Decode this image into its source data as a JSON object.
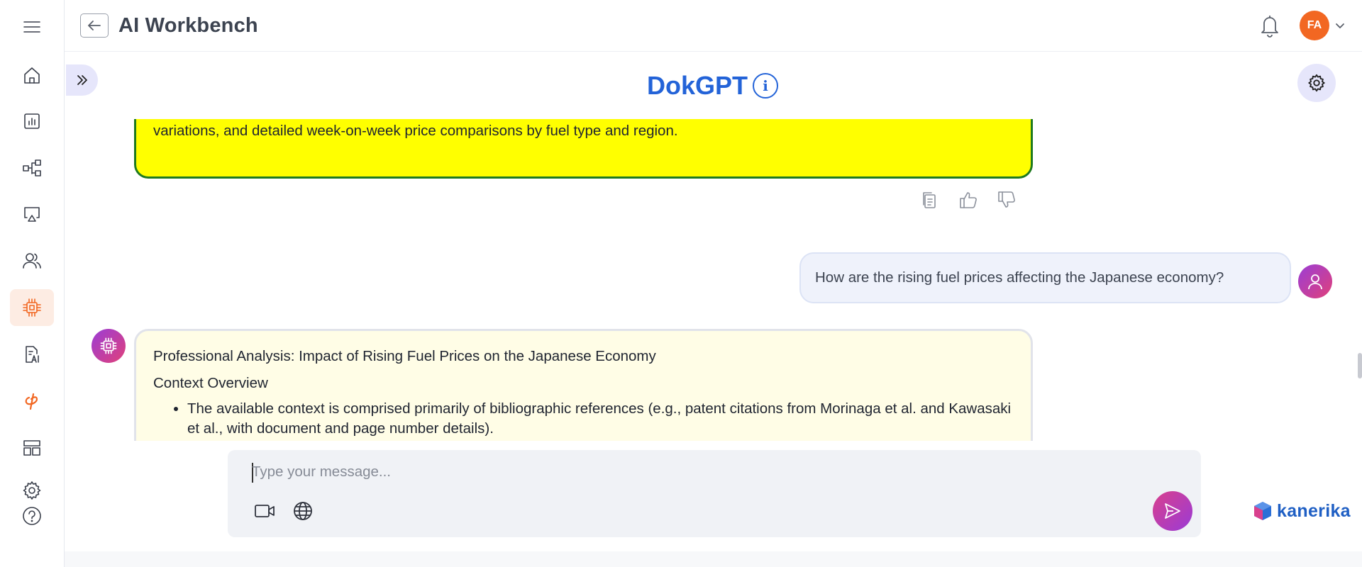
{
  "header": {
    "app_title": "AI Workbench",
    "avatar_initials": "FA"
  },
  "sidebar": {
    "items": [
      {
        "icon": "hamburger-menu-icon"
      },
      {
        "icon": "home-icon"
      },
      {
        "icon": "bar-chart-icon"
      },
      {
        "icon": "workflow-icon"
      },
      {
        "icon": "presentation-icon"
      },
      {
        "icon": "users-icon"
      },
      {
        "icon": "cpu-chip-icon",
        "active": true
      },
      {
        "icon": "ai-document-icon"
      },
      {
        "icon": "phi-icon"
      },
      {
        "icon": "layout-icon"
      },
      {
        "icon": "settings-gear-icon"
      },
      {
        "icon": "help-icon"
      }
    ]
  },
  "page": {
    "title": "DokGPT",
    "info_glyph": "i"
  },
  "chat": {
    "previous_answer_tail": "variations, and detailed week-on-week price comparisons by fuel type and region.",
    "user_question": "How are the rising fuel prices affecting the Japanese economy?",
    "answer": {
      "heading": "Professional Analysis: Impact of Rising Fuel Prices on the Japanese Economy",
      "subheading": "Context Overview",
      "bullets": [
        "The available context is comprised primarily of bibliographic references (e.g., patent citations from Morinaga et al. and Kawasaki et al., with document and page number details)."
      ]
    }
  },
  "composer": {
    "placeholder": "Type your message..."
  },
  "brand": {
    "name": "kanerika"
  },
  "colors": {
    "accent_blue": "#2363d8",
    "accent_orange": "#f26722",
    "highlight_yellow": "#ffff00",
    "highlight_border": "#1f7a1f",
    "answer_bg": "#fffde6"
  }
}
